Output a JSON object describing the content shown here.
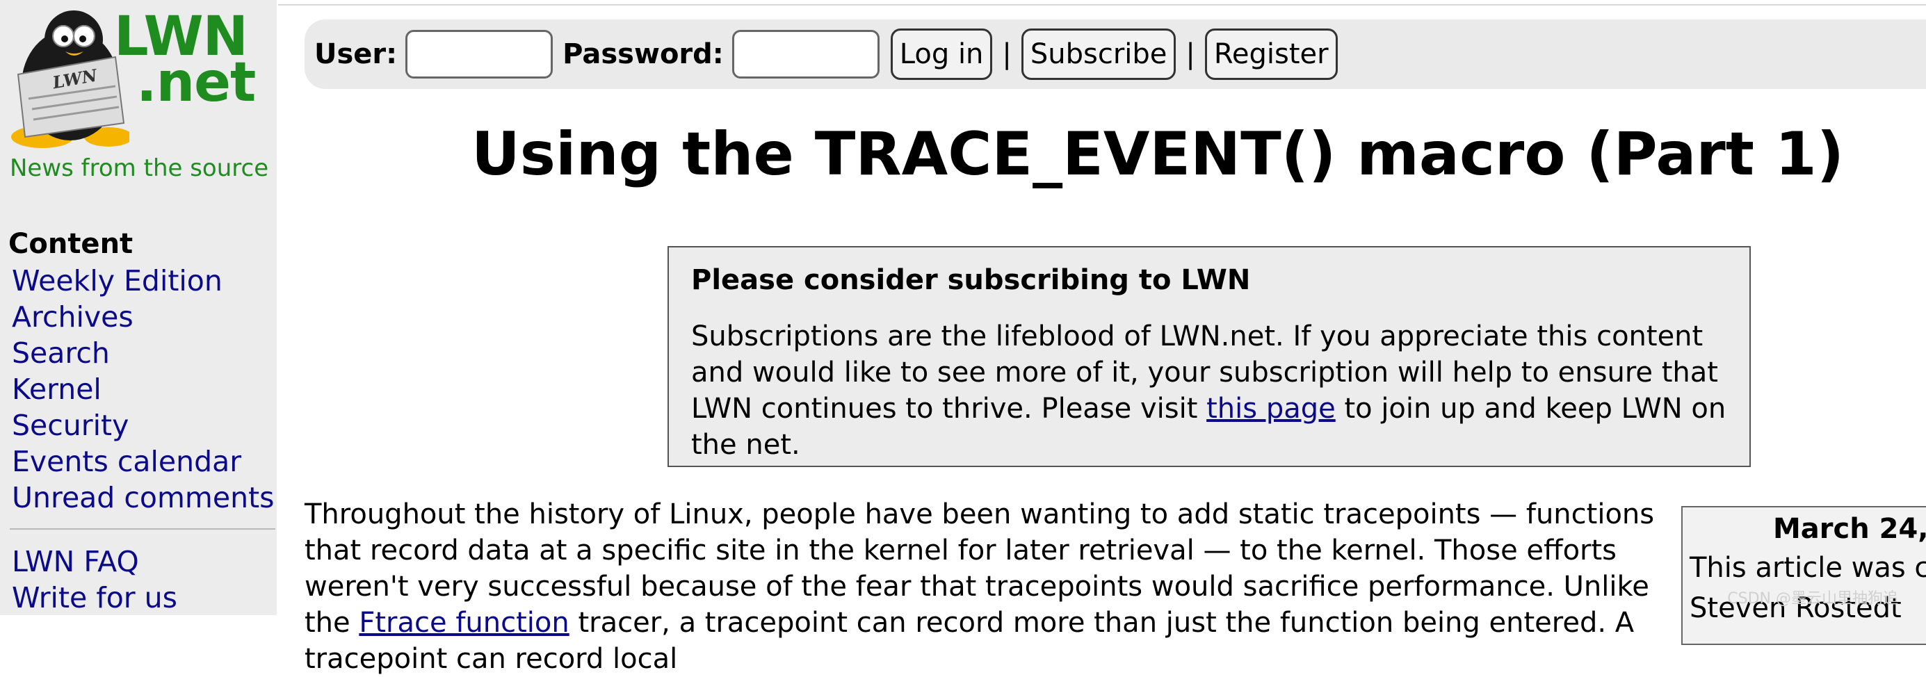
{
  "sidebar": {
    "logo_line1": "LWN",
    "logo_line2": ".net",
    "logo_badge": "LWN",
    "tagline": "News from the source",
    "heading": "Content",
    "items": [
      {
        "label": "Weekly Edition"
      },
      {
        "label": "Archives"
      },
      {
        "label": "Search"
      },
      {
        "label": "Kernel"
      },
      {
        "label": "Security"
      },
      {
        "label": "Events calendar"
      },
      {
        "label": "Unread comments"
      }
    ],
    "items2": [
      {
        "label": "LWN FAQ"
      },
      {
        "label": "Write for us"
      }
    ]
  },
  "login": {
    "user_label": "User:",
    "password_label": "Password:",
    "login_button": "Log in",
    "separator": "|",
    "subscribe_button": "Subscribe",
    "register_button": "Register"
  },
  "article": {
    "title": "Using the TRACE_EVENT() macro (Part 1)",
    "notice": {
      "heading": "Please consider subscribing to LWN",
      "body_before": "Subscriptions are the lifeblood of LWN.net. If you appreciate this content and would like to see more of it, your subscription will help to ensure that LWN continues to thrive. Please visit ",
      "link": "this page",
      "body_after": " to join up and keep LWN on the net."
    },
    "para_before": "Throughout the history of Linux, people have been wanting to add static tracepoints — functions that record data at a specific site in the kernel for later retrieval — to the kernel. Those efforts weren't very successful because of the fear that tracepoints would sacrifice performance. Unlike the ",
    "para_link": "Ftrace function",
    "para_after": " tracer, a tracepoint can record more than just the function being entered. A tracepoint can record local",
    "sidebox_date": "March 24,",
    "sidebox_line1": "This article was co",
    "sidebox_line2": "Steven Rostedt"
  },
  "watermark": "CSDN @墨云山里抽狗追",
  "colors": {
    "brand_green": "#1f8c1f",
    "link_blue": "#0b0b8a",
    "sidebar_bg": "#ececec"
  }
}
